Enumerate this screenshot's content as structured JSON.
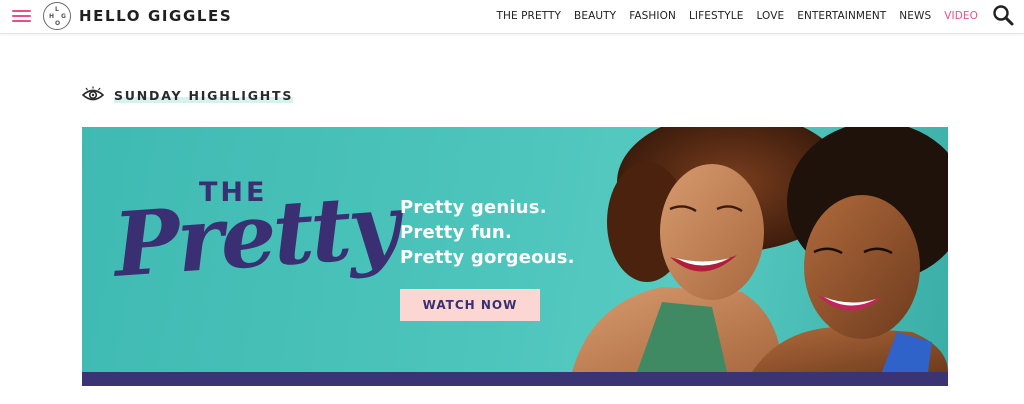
{
  "header": {
    "logo_text": "HELLO GIGGLES",
    "logo_letters": [
      "H",
      "G",
      "L",
      "O"
    ],
    "nav": [
      {
        "label": "THE PRETTY",
        "active": false
      },
      {
        "label": "BEAUTY",
        "active": false
      },
      {
        "label": "FASHION",
        "active": false
      },
      {
        "label": "LIFESTYLE",
        "active": false
      },
      {
        "label": "LOVE",
        "active": false
      },
      {
        "label": "ENTERTAINMENT",
        "active": false
      },
      {
        "label": "NEWS",
        "active": false
      },
      {
        "label": "VIDEO",
        "active": true
      }
    ],
    "icons": {
      "menu": "hamburger-menu-icon",
      "search": "search-icon"
    }
  },
  "section": {
    "title": "SUNDAY HIGHLIGHTS",
    "icon": "eye-icon"
  },
  "banner": {
    "brand_the": "THE",
    "brand_script": "Pretty",
    "taglines": [
      "Pretty genius.",
      "Pretty fun.",
      "Pretty gorgeous."
    ],
    "cta_label": "WATCH NOW"
  },
  "colors": {
    "accent_pink": "#e94f8a",
    "banner_teal": "#4cc4bb",
    "brand_purple": "#3a2f72",
    "cta_bg": "#fbd6d3"
  }
}
